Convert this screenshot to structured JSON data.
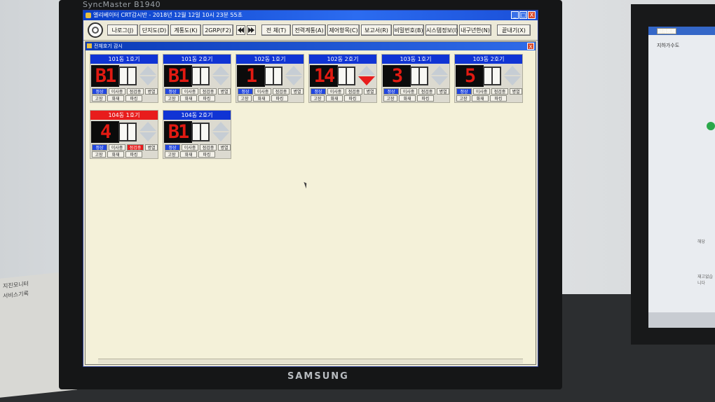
{
  "monitor": {
    "brand_top": "SyncMaster B1940",
    "brand_bottom": "SAMSUNG"
  },
  "paper_labels": [
    "지진모니터",
    "서비스기록"
  ],
  "side_screen": {
    "title": "원격통제",
    "line2": "지하가수도",
    "note1": "해당",
    "note2": "재고없습니다"
  },
  "window": {
    "title": "엘리베이터 CRT감시반 - 2018년 12월 12일 10시 23분 55초",
    "buttons": {
      "minimize": "_",
      "restore": "□",
      "close": "X"
    }
  },
  "toolbar": {
    "items": [
      {
        "label": "나로그(J)"
      },
      {
        "label": "단지도(D)"
      },
      {
        "label": "계통도(K)"
      },
      {
        "label": "2GRP(F2)"
      },
      {
        "label": "전 체(T)"
      },
      {
        "label": "전력계통(A)"
      },
      {
        "label": "제어항목(C)"
      },
      {
        "label": "보고서(R)"
      },
      {
        "label": "비밀번호(B)"
      },
      {
        "label": "시스템정보(I)"
      },
      {
        "label": "내구년한(N)"
      },
      {
        "label": "끝내기(X)"
      }
    ]
  },
  "inner_window": {
    "title": "전체호기 감시",
    "close": "X"
  },
  "status_labels": {
    "normal": "정상",
    "moving": "이사중",
    "inspection": "점검중",
    "stop": "병열",
    "fault": "고장",
    "out": "화재",
    "power": "파킹"
  },
  "elevators": [
    {
      "name": "101동 1호기",
      "floor": "B1",
      "dir": "none",
      "alarm": false,
      "inspect_red": false
    },
    {
      "name": "101동 2호기",
      "floor": "B1",
      "dir": "none",
      "alarm": false,
      "inspect_red": false
    },
    {
      "name": "102동 1호기",
      "floor": "1",
      "dir": "none",
      "alarm": false,
      "inspect_red": false
    },
    {
      "name": "102동 2호기",
      "floor": "14",
      "dir": "down",
      "alarm": false,
      "inspect_red": false
    },
    {
      "name": "103동 1호기",
      "floor": "3",
      "dir": "none",
      "alarm": false,
      "inspect_red": false
    },
    {
      "name": "103동 2호기",
      "floor": "5",
      "dir": "none",
      "alarm": false,
      "inspect_red": false
    },
    {
      "name": "104동 1호기",
      "floor": "4",
      "dir": "none",
      "alarm": true,
      "inspect_red": true
    },
    {
      "name": "104동 2호기",
      "floor": "B1",
      "dir": "none",
      "alarm": false,
      "inspect_red": false
    }
  ]
}
